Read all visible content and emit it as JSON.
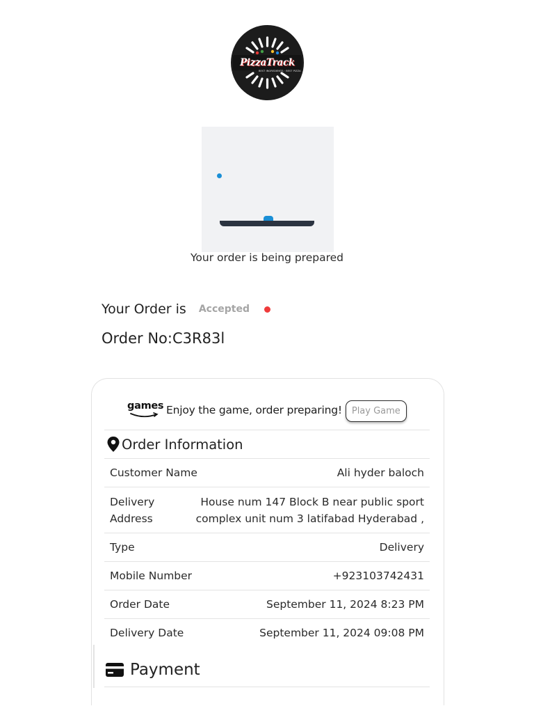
{
  "brand": {
    "logo_text": "PizzaTrack",
    "logo_tagline": "BEST INGREDIENTS · BEST PIZZA"
  },
  "preparation": {
    "status_text": "Your order is being prepared"
  },
  "order_status": {
    "label": "Your Order is",
    "value": "Accepted",
    "indicator_color": "#ef3b3b"
  },
  "order_number": {
    "label": "Order No:",
    "value": "C3R83l"
  },
  "game_banner": {
    "logo_text": "games",
    "message": "Enjoy the game, order preparing!",
    "button_label": "Play Game"
  },
  "order_information": {
    "title": "Order Information",
    "icon": "location-pin-icon",
    "rows": [
      {
        "label": "Customer Name",
        "value": "Ali hyder baloch"
      },
      {
        "label": "Delivery Address",
        "value": "House num 147 Block B near public sport complex unit num 3 latifabad Hyderabad ,"
      },
      {
        "label": "Type",
        "value": "Delivery"
      },
      {
        "label": "Mobile Number",
        "value": "+923103742431"
      },
      {
        "label": "Order Date",
        "value": "September 11, 2024 8:23 PM"
      },
      {
        "label": "Delivery Date",
        "value": "September 11, 2024 09:08 PM"
      }
    ]
  },
  "payment": {
    "title": "Payment",
    "icon": "credit-card-icon"
  },
  "colors": {
    "accent_blue": "#1a8fd6",
    "paddle": "#2b3340",
    "status_dot": "#ef3b3b"
  }
}
